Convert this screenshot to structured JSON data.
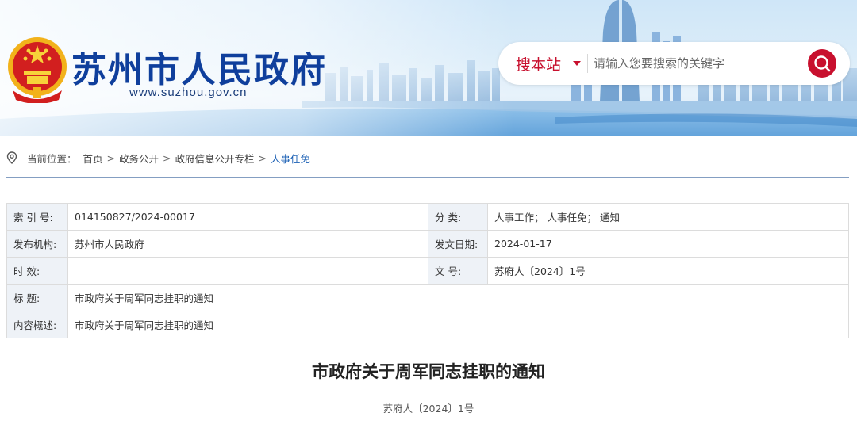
{
  "header": {
    "site_title": "苏州市人民政府",
    "site_url": "www.suzhou.gov.cn",
    "emblem_icon": "national-emblem-icon"
  },
  "search": {
    "scope_label": "搜本站",
    "placeholder": "请输入您要搜索的关键字",
    "button_icon": "search-icon",
    "accent_color": "#c8102e"
  },
  "breadcrumb": {
    "prefix": "当前位置：",
    "items": [
      "首页",
      "政务公开",
      "政府信息公开专栏",
      "人事任免"
    ],
    "separator": ">"
  },
  "info": {
    "index_label": "索 引 号:",
    "index_value": "014150827/2024-00017",
    "category_label": "分    类:",
    "category_value": "人事工作；  人事任免；  通知",
    "publisher_label": "发布机构:",
    "publisher_value": "苏州市人民政府",
    "date_label": "发文日期:",
    "date_value": "2024-01-17",
    "validity_label": "时    效:",
    "validity_value": "",
    "docno_label": "文    号:",
    "docno_value": "苏府人〔2024〕1号",
    "title_label": "标    题:",
    "title_value": "市政府关于周军同志挂职的通知",
    "summary_label": "内容概述:",
    "summary_value": "市政府关于周军同志挂职的通知"
  },
  "article": {
    "title": "市政府关于周军同志挂职的通知",
    "doc_number": "苏府人〔2024〕1号"
  }
}
